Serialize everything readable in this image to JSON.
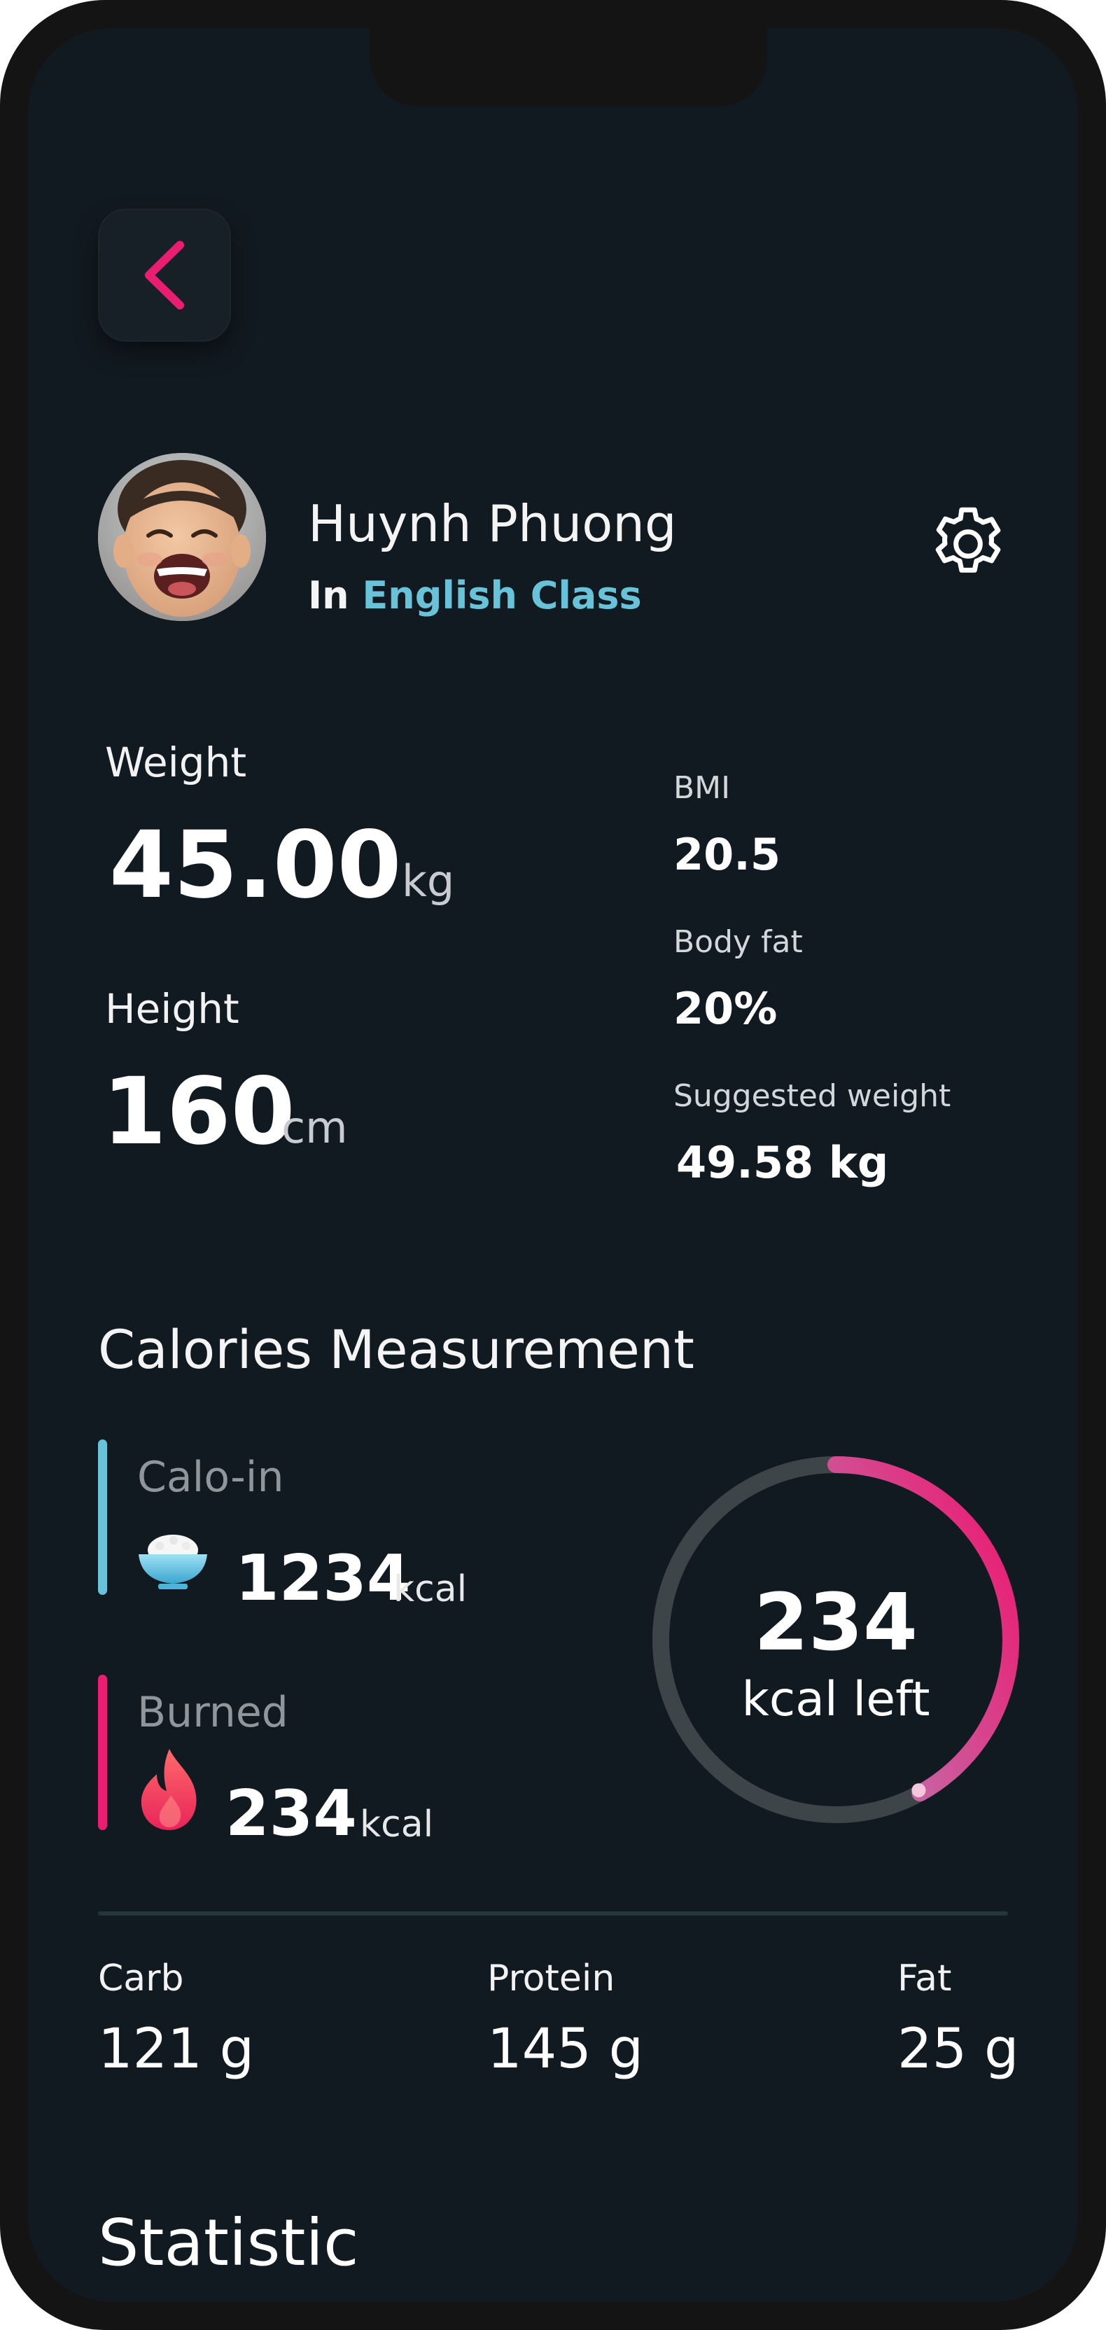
{
  "profile": {
    "name": "Huynh Phuong",
    "class_prefix": "In",
    "class_name": "English Class"
  },
  "metrics": {
    "weight": {
      "label": "Weight",
      "value": "45.00",
      "unit": "kg"
    },
    "height": {
      "label": "Height",
      "value": "160",
      "unit": "cm"
    },
    "bmi": {
      "label": "BMI",
      "value": "20.5"
    },
    "body_fat": {
      "label": "Body fat",
      "value": "20%"
    },
    "suggested_weight": {
      "label": "Suggested weight",
      "value": "49.58 kg"
    }
  },
  "calories": {
    "title": "Calories Measurement",
    "calo_in": {
      "label": "Calo-in",
      "value": "1234",
      "unit": "kcal",
      "icon": "rice-bowl-icon",
      "color": "#69c3d8"
    },
    "burned": {
      "label": "Burned",
      "value": "234",
      "unit": "kcal",
      "icon": "flame-icon",
      "color": "#e91e73"
    },
    "remaining": {
      "value": "234",
      "label": "kcal left",
      "progress_fraction": 0.42
    }
  },
  "macros": [
    {
      "label": "Carb",
      "value": "121 g"
    },
    {
      "label": "Protein",
      "value": "145 g"
    },
    {
      "label": "Fat",
      "value": "25 g"
    }
  ],
  "statistic_title": "Statistic",
  "colors": {
    "background": "#121a21",
    "accent_pink": "#e91e73",
    "accent_cyan": "#69c3d8",
    "ring_track": "#3d4548"
  }
}
